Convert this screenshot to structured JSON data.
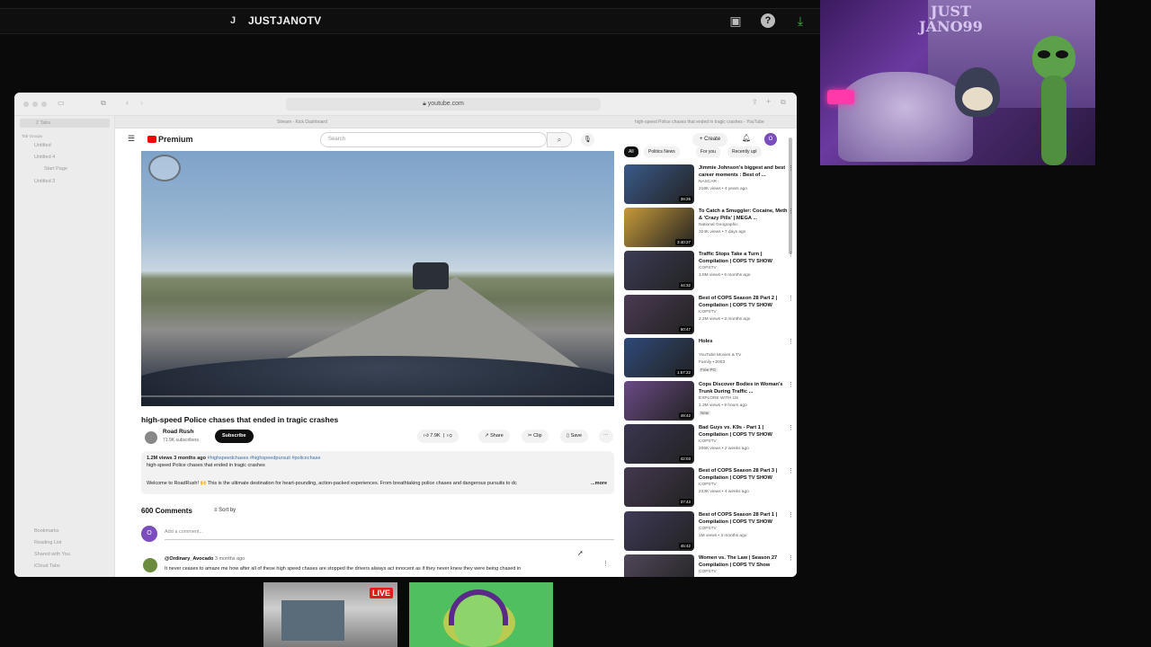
{
  "stream": {
    "channel_initial": "J",
    "channel_name": "JUSTJANOTV",
    "webcam_sign": "JUST\nJANO99"
  },
  "browser": {
    "url": "youtube.com",
    "tabs": [
      "Stream - Kick Dashboard",
      "high-speed Police chases that ended in tragic crashes - YouTube"
    ],
    "sidebar": {
      "tabs_count": "2 Tabs",
      "tab_groups_label": "Tab Groups",
      "groups": [
        "Untitled",
        "Untitled 4",
        "Start Page",
        "Untitled 3"
      ],
      "footer": [
        "Bookmarks",
        "Reading List",
        "Shared with You",
        "iCloud Tabs"
      ]
    }
  },
  "youtube": {
    "logo": "Premium",
    "search_placeholder": "Search",
    "create_label": "Create",
    "avatar_letter": "O",
    "video": {
      "title": "high-speed Police chases that ended in tragic crashes",
      "channel": "Road Rush",
      "subscribers": "71.9K subscribers",
      "subscribe_label": "Subscribe",
      "likes": "7.9K",
      "share": "Share",
      "clip": "Clip",
      "save": "Save",
      "description": {
        "meta": "1.2M views  3 months ago",
        "tags": "#highspeedchases #highspeedpursuit #policechase",
        "line2": "high-speed Police chases that ended in tragic crashes",
        "line3": "Welcome to RoadRush! 🙌 This is the ultimate destination for heart-pounding, action-packed experiences. From breathtaking police chases and dangerous pursuits to dc",
        "more": "...more"
      }
    },
    "comments": {
      "count": "600 Comments",
      "sort_by": "Sort by",
      "add_placeholder": "Add a comment...",
      "avatar_letter": "O",
      "first": {
        "user": "@Ordinary_Avocado",
        "time": "3 months ago",
        "text": "It never ceases to amaze me how after all of these high speed chases are stopped the drivers always act innocent as if they never knew they were being chased in"
      }
    },
    "chips": [
      "All",
      "Politics News",
      "For you",
      "Recently upl"
    ],
    "recommendations": [
      {
        "title": "Jimmie Johnson's biggest and best career moments : Best of ...",
        "channel": "NASCAR",
        "meta": "218K views • 4 years ago",
        "duration": "39:26",
        "thumb_color": "#3a5a8a"
      },
      {
        "title": "To Catch a Smuggler: Cocaine, Meth & 'Crazy Pills' | MEGA ...",
        "channel": "National Geographic",
        "meta": "324K views • 7 days ago",
        "duration": "3:40:27",
        "thumb_color": "#c79a3a"
      },
      {
        "title": "Traffic Stops Take a Turn | Compilation | COPS TV SHOW",
        "channel": "COPSTV",
        "meta": "1.8M views • 6 months ago",
        "duration": "44:32",
        "thumb_color": "#3b3b55"
      },
      {
        "title": "Best of COPS Season 28 Part 2 | Compilation | COPS TV SHOW",
        "channel": "COPSTV",
        "meta": "2.2M views • 3 months ago",
        "duration": "50:47",
        "thumb_color": "#4a3a52"
      },
      {
        "title": "Holes",
        "channel": "YouTube Movies & TV",
        "meta": "Family • 2003",
        "duration": "1:57:22",
        "thumb_color": "#2e4a78",
        "badge": "Free  PG"
      },
      {
        "title": "Cops Discover Bodies in Woman's Trunk During Traffic ...",
        "channel": "EXPLORE WITH US",
        "meta": "1.3M views • 9 hours ago",
        "duration": "49:42",
        "thumb_color": "#6a4a86",
        "badge": "New"
      },
      {
        "title": "Bad Guys vs. K9s - Part 1 | Compilation | COPS TV SHOW",
        "channel": "COPSTV",
        "meta": "206K views • 2 weeks ago",
        "duration": "42:03",
        "thumb_color": "#3a3650"
      },
      {
        "title": "Best of COPS Season 28 Part 3 | Compilation | COPS TV SHOW",
        "channel": "COPSTV",
        "meta": "233K views • 4 weeks ago",
        "duration": "37:43",
        "thumb_color": "#44384e"
      },
      {
        "title": "Best of COPS Season 28 Part 1 | Compilation | COPS TV SHOW",
        "channel": "COPSTV",
        "meta": "1M views • 3 months ago",
        "duration": "45:42",
        "thumb_color": "#3e3a58"
      },
      {
        "title": "Women vs. The Law | Season 27 Compilation | COPS TV Show",
        "channel": "COPSTV",
        "meta": "",
        "duration": "",
        "thumb_color": "#504658"
      }
    ]
  },
  "bottom": {
    "live_label": "LIVE"
  },
  "colors": {
    "youtube_red": "#ff0000",
    "live_red": "#e21b1b",
    "accent_purple": "#7c4dbd"
  }
}
